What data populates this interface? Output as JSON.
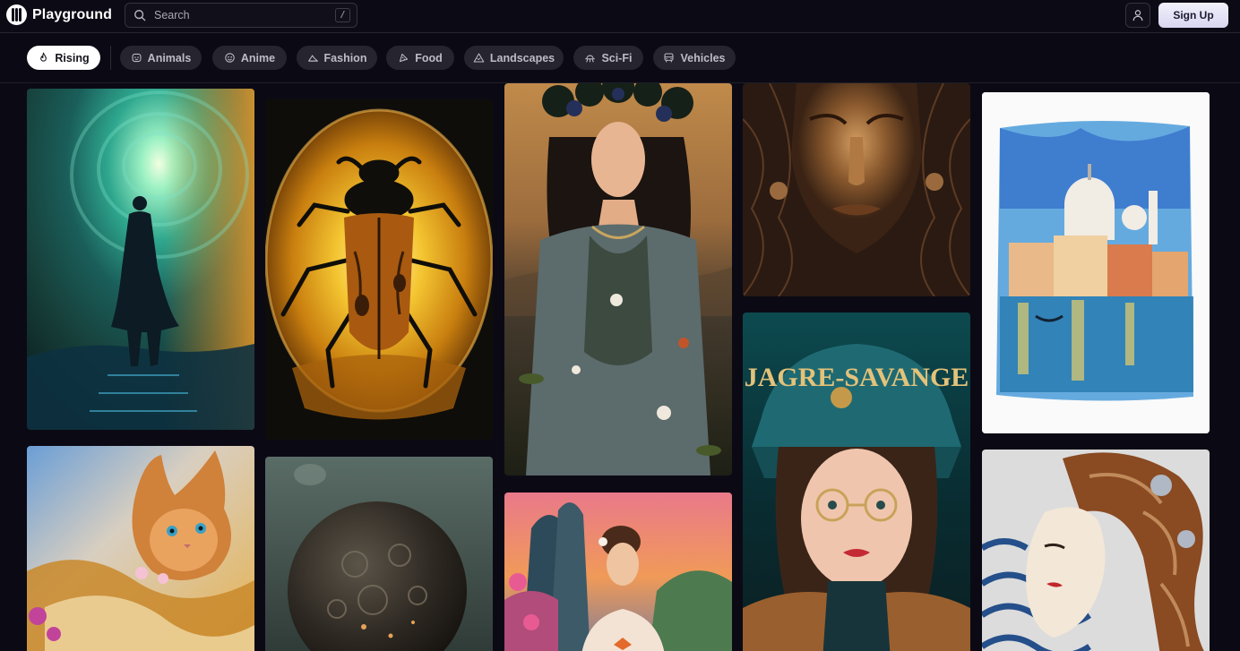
{
  "app": {
    "name": "Playground"
  },
  "search": {
    "placeholder": "Search",
    "shortcut": "/"
  },
  "header": {
    "signup_label": "Sign Up"
  },
  "categories": [
    {
      "label": "Rising",
      "icon": "flame-icon",
      "active": true
    },
    {
      "label": "Animals",
      "icon": "animal-icon",
      "active": false
    },
    {
      "label": "Anime",
      "icon": "anime-icon",
      "active": false
    },
    {
      "label": "Fashion",
      "icon": "fashion-icon",
      "active": false
    },
    {
      "label": "Food",
      "icon": "food-icon",
      "active": false
    },
    {
      "label": "Landscapes",
      "icon": "mountain-icon",
      "active": false
    },
    {
      "label": "Sci-Fi",
      "icon": "scifi-icon",
      "active": false
    },
    {
      "label": "Vehicles",
      "icon": "vehicle-icon",
      "active": false
    }
  ],
  "gallery": {
    "images": [
      {
        "name": "man-in-swirling-tunnel"
      },
      {
        "name": "beetle-in-amber"
      },
      {
        "name": "woman-with-floral-crown"
      },
      {
        "name": "bronze-face-sculpture"
      },
      {
        "name": "venice-watercolor"
      },
      {
        "name": "fluffy-kitten"
      },
      {
        "name": "dark-sphere-planet"
      },
      {
        "name": "woman-portrait-sunset"
      },
      {
        "name": "woman-in-cap",
        "caption_text": "JAGRE-SAVANGE"
      },
      {
        "name": "art-deco-woman"
      }
    ]
  },
  "colors": {
    "background": "#0b0a14",
    "chip": "#25242f",
    "chip_active": "#ffffff",
    "accent": "#d9d7f0"
  }
}
